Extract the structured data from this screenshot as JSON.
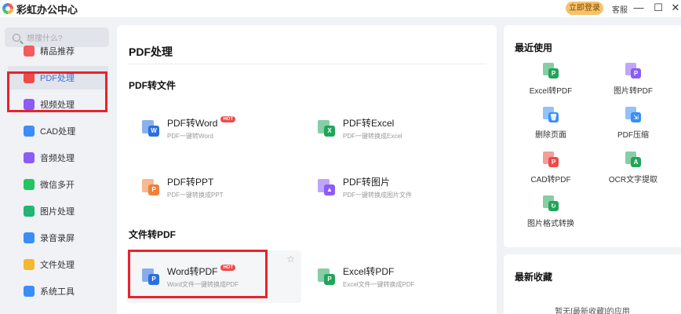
{
  "app": {
    "title": "彩虹办公中心"
  },
  "titlebar": {
    "login_label": "立即登录",
    "service_label": "客服",
    "minimize": "—",
    "maximize": "☐",
    "close": "✕"
  },
  "sidebar": {
    "search_placeholder": "想搜什么?",
    "items": [
      {
        "label": "精品推荐",
        "icon": "thumbs-up-icon",
        "color": "#f25c5c"
      },
      {
        "label": "PDF处理",
        "icon": "pdf-icon",
        "color": "#ef4a4a",
        "active": true
      },
      {
        "label": "视频处理",
        "icon": "video-icon",
        "color": "#8b5cf6"
      },
      {
        "label": "CAD处理",
        "icon": "cad-icon",
        "color": "#3a8ef6"
      },
      {
        "label": "音频处理",
        "icon": "audio-icon",
        "color": "#8b5cf6"
      },
      {
        "label": "微信多开",
        "icon": "wechat-icon",
        "color": "#22c55e"
      },
      {
        "label": "图片处理",
        "icon": "image-icon",
        "color": "#22b573"
      },
      {
        "label": "录音录屏",
        "icon": "mic-icon",
        "color": "#3a8ef6"
      },
      {
        "label": "文件处理",
        "icon": "folder-icon",
        "color": "#f5b82e"
      },
      {
        "label": "系统工具",
        "icon": "gear-icon",
        "color": "#3a8ef6"
      }
    ]
  },
  "main": {
    "title": "PDF处理",
    "sections": [
      {
        "title": "PDF转文件",
        "tools": [
          {
            "name": "PDF转Word",
            "desc": "PDF一键转Word",
            "hot": "HOT",
            "badge": "W",
            "color": "#2b6fe0"
          },
          {
            "name": "PDF转Excel",
            "desc": "PDF一键转换成Excel",
            "badge": "X",
            "color": "#22a559"
          },
          {
            "name": "PDF转PPT",
            "desc": "PDF一键转换成PPT",
            "badge": "P",
            "color": "#f0803a"
          },
          {
            "name": "PDF转图片",
            "desc": "PDF一键转换成图片文件",
            "badge": "▲",
            "color": "#8b5cf6"
          }
        ]
      },
      {
        "title": "文件转PDF",
        "tools": [
          {
            "name": "Word转PDF",
            "desc": "Word文件一键转换成PDF",
            "hot": "HOT",
            "badge": "P",
            "color": "#2b6fe0"
          },
          {
            "name": "Excel转PDF",
            "desc": "Excel文件一键转换成PDF",
            "badge": "P",
            "color": "#22a559"
          }
        ]
      }
    ]
  },
  "recent": {
    "title": "最近使用",
    "items": [
      {
        "label": "Excel转PDF",
        "icon": "excel-to-pdf-icon",
        "color": "#22a559",
        "badge": "P"
      },
      {
        "label": "图片转PDF",
        "icon": "image-to-pdf-icon",
        "color": "#8b5cf6",
        "badge": "P"
      },
      {
        "label": "删除页面",
        "icon": "delete-page-icon",
        "color": "#3a8ef6",
        "badge": "🗑"
      },
      {
        "label": "PDF压缩",
        "icon": "compress-icon",
        "color": "#3a8ef6",
        "badge": "⇲"
      },
      {
        "label": "CAD转PDF",
        "icon": "cad-to-pdf-icon",
        "color": "#ef4a4a",
        "badge": "P"
      },
      {
        "label": "OCR文字提取",
        "icon": "ocr-icon",
        "color": "#22a559",
        "badge": "A"
      },
      {
        "label": "图片格式转换",
        "icon": "image-convert-icon",
        "color": "#22a559",
        "badge": "↻"
      }
    ]
  },
  "favorites": {
    "title": "最新收藏",
    "empty_text": "暂无[最新收藏]的应用"
  }
}
